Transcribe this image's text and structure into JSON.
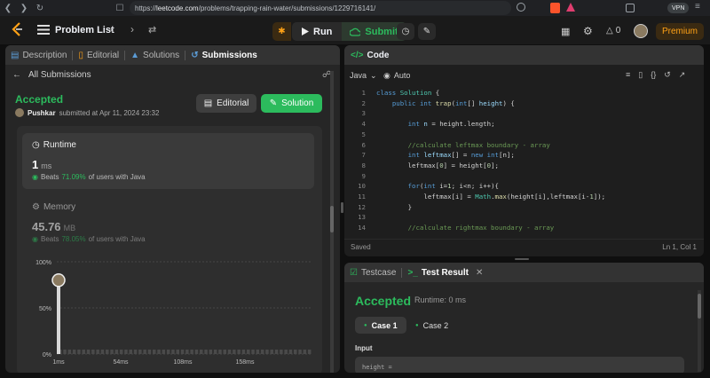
{
  "browser": {
    "url_prefix": "https://",
    "url_domain": "leetcode.com",
    "url_path": "/problems/trapping-rain-water/submissions/1229716141/",
    "vpn": "VPN"
  },
  "nav": {
    "problem_list": "Problem List",
    "run": "Run",
    "submit": "Submit",
    "coins": "0",
    "premium": "Premium"
  },
  "tabs": [
    {
      "label": "Description",
      "icon": "description-icon"
    },
    {
      "label": "Editorial",
      "icon": "book-icon"
    },
    {
      "label": "Solutions",
      "icon": "flask-icon"
    },
    {
      "label": "Submissions",
      "icon": "history-icon"
    }
  ],
  "submission": {
    "back_label": "All Submissions",
    "status": "Accepted",
    "user": "Pushkar",
    "submitted_text": "submitted at Apr 11, 2024 23:32",
    "editorial_btn": "Editorial",
    "solution_btn": "Solution"
  },
  "runtime": {
    "label": "Runtime",
    "value": "1",
    "unit": "ms",
    "beats_prefix": "Beats",
    "beats_pct": "71.09%",
    "beats_suffix": "of users with Java"
  },
  "memory": {
    "label": "Memory",
    "value": "45.76",
    "unit": "MB",
    "beats_prefix": "Beats",
    "beats_pct": "78.05%",
    "beats_suffix": "of users with Java"
  },
  "chart_data": {
    "type": "bar",
    "y_ticks": [
      "100%",
      "50%",
      "0%"
    ],
    "x_ticks": [
      "1ms",
      "54ms",
      "108ms",
      "158ms"
    ],
    "ylim": [
      0,
      100
    ],
    "grid": true,
    "marker_x": "1ms",
    "marker_y": 80
  },
  "code": {
    "title": "Code",
    "language": "Java",
    "mode": "Auto",
    "status": "Saved",
    "cursor": "Ln 1, Col 1",
    "lines": [
      {
        "n": "1",
        "html": "<span class=\"kw\">class</span> <span class=\"cls\">Solution</span> {"
      },
      {
        "n": "2",
        "html": "    <span class=\"kw\">public</span> <span class=\"kw\">int</span> <span class=\"fn\">trap</span>(<span class=\"kw\">int</span>[] <span class=\"vr\">height</span>) {"
      },
      {
        "n": "3",
        "html": ""
      },
      {
        "n": "4",
        "html": "        <span class=\"kw\">int</span> <span class=\"vr\">n</span> = height.length;"
      },
      {
        "n": "5",
        "html": ""
      },
      {
        "n": "6",
        "html": "        <span class=\"cm\">//calculate leftmax boundary - array</span>"
      },
      {
        "n": "7",
        "html": "        <span class=\"kw\">int</span> <span class=\"vr\">leftmax</span>[] = <span class=\"kw\">new</span> <span class=\"kw\">int</span>[n];"
      },
      {
        "n": "8",
        "html": "        leftmax[<span class=\"nm\">0</span>] = height[<span class=\"nm\">0</span>];"
      },
      {
        "n": "9",
        "html": ""
      },
      {
        "n": "10",
        "html": "        <span class=\"kw\">for</span>(<span class=\"kw\">int</span> i=<span class=\"nm\">1</span>; i&lt;n; i++){"
      },
      {
        "n": "11",
        "html": "            leftmax[i] = <span class=\"cls\">Math</span>.<span class=\"fn\">max</span>(height[i],leftmax[i-<span class=\"nm\">1</span>]);"
      },
      {
        "n": "12",
        "html": "        }"
      },
      {
        "n": "13",
        "html": ""
      },
      {
        "n": "14",
        "html": "        <span class=\"cm\">//calculate rightmax boundary - array</span>"
      }
    ]
  },
  "result": {
    "testcase_tab": "Testcase",
    "result_tab": "Test Result",
    "status": "Accepted",
    "runtime": "Runtime: 0 ms",
    "case1": "Case 1",
    "case2": "Case 2",
    "input_label": "Input",
    "input_value": "height ="
  }
}
